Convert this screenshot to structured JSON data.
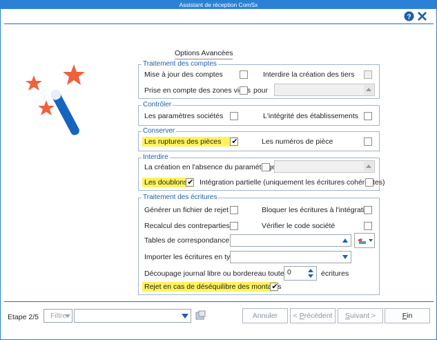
{
  "window": {
    "title": "Assistant de réception ComSx"
  },
  "panel": {
    "title": "Options Avancées"
  },
  "groups": {
    "comptes": {
      "legend": "Traitement des comptes",
      "maj_label": "Mise à jour des comptes",
      "interdire_tiers_label": "Interdire la création des tiers",
      "zones_vides_label": "Prise en compte des zones vides",
      "pour_label": "pour"
    },
    "controler": {
      "legend": "Contrôler",
      "params_label": "Les paramètres sociétés",
      "integrite_label": "L'intégrité des établissements"
    },
    "conserver": {
      "legend": "Conserver",
      "ruptures_label": "Les ruptures des pièces",
      "numeros_label": "Les numéros de pièce"
    },
    "interdire": {
      "legend": "Interdire",
      "creation_label": "La création en l'absence du paramétrage",
      "doublons_label": "Les doublons",
      "integration_label": "Intégration partielle (uniquement les écritures cohérentes)"
    },
    "ecritures": {
      "legend": "Traitement des écritures",
      "rejet_label": "Générer un fichier de rejet",
      "bloquer_label": "Bloquer les écritures à l'intégration",
      "recalcul_label": "Recalcul des contreparties",
      "verifier_label": "Vérifier le code société",
      "tables_label": "Tables de correspondance",
      "importer_label": "Importer les écritures en type",
      "decoupage_label": "Découpage journal libre ou bordereau toutes les",
      "decoupage_value": "0",
      "ecritures_suffix": "écritures",
      "desequilibre_label": "Rejet en cas de déséquilibre des montants"
    }
  },
  "checks": {
    "maj": false,
    "interdire_tiers": false,
    "zones_vides": false,
    "params": false,
    "integrite": false,
    "ruptures": true,
    "numeros": false,
    "creation": false,
    "doublons": true,
    "integration": false,
    "rejet": false,
    "bloquer": false,
    "recalcul": false,
    "verifier": false,
    "desequilibre": true
  },
  "footer": {
    "step": "Etape 2/5",
    "filtre_label": "Filtre",
    "annuler": "Annuler",
    "precedent_prefix": "< ",
    "precedent_underlined": "P",
    "precedent_rest": "récédent",
    "suivant_underlined": "S",
    "suivant_rest": "uivant >",
    "fin_underlined": "F",
    "fin_rest": "in"
  },
  "colors": {
    "accent": "#2b81d6",
    "legend": "#1e5fae",
    "highlight": "#fff35a",
    "star": "#f0613a",
    "wand": "#1565c0"
  },
  "icons": [
    "help-icon",
    "close-icon",
    "magic-wand-icon",
    "spin-up-icon",
    "spin-down-icon",
    "dropdown-arrow-icon",
    "table-lookup-icon",
    "filter-settings-icon"
  ]
}
